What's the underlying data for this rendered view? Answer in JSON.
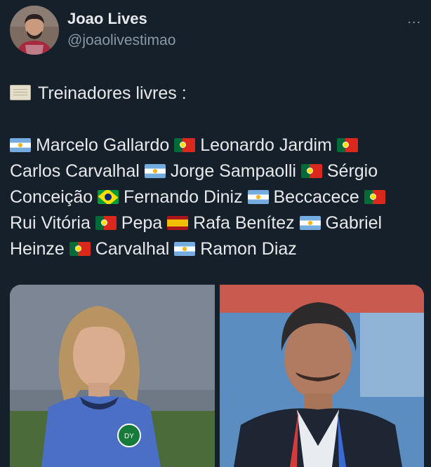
{
  "author": {
    "name": "Joao Lives",
    "handle": "@joaolivestimao",
    "avatar_icon": "user-avatar-photo"
  },
  "menu": {
    "label": "..."
  },
  "tweet": {
    "header_icon": "scroll-emoji",
    "header": "Treinadores livres :",
    "lines": [
      [
        {
          "flag": "argentina"
        },
        {
          "text": "Marcelo Gallardo"
        },
        {
          "flag": "portugal"
        },
        {
          "text": "Leonardo Jardim"
        },
        {
          "flag": "portugal"
        }
      ],
      [
        {
          "text": "Carlos Carvalhal"
        },
        {
          "flag": "argentina"
        },
        {
          "text": "Jorge Sampaolli"
        },
        {
          "flag": "portugal"
        },
        {
          "text": "Sérgio"
        }
      ],
      [
        {
          "text": "Conceição"
        },
        {
          "flag": "brazil"
        },
        {
          "text": "Fernando Diniz"
        },
        {
          "flag": "argentina"
        },
        {
          "text": "Beccacece"
        },
        {
          "flag": "portugal"
        }
      ],
      [
        {
          "text": "Rui Vitória"
        },
        {
          "flag": "portugal"
        },
        {
          "text": "Pepa"
        },
        {
          "flag": "spain"
        },
        {
          "text": "Rafa Benítez"
        },
        {
          "flag": "argentina"
        },
        {
          "text": "Gabriel"
        }
      ],
      [
        {
          "text": "Heinze"
        },
        {
          "flag": "portugal"
        },
        {
          "text": "Carvalhal"
        },
        {
          "flag": "argentina"
        },
        {
          "text": "Ramon Diaz"
        }
      ]
    ]
  },
  "media": [
    {
      "subject": "long-haired coach in green jersey"
    },
    {
      "subject": "grey-haired coach in dark suit"
    }
  ]
}
